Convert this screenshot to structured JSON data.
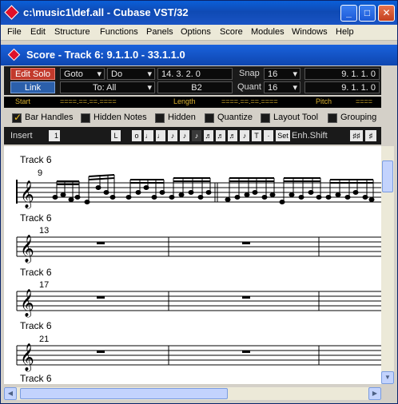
{
  "window": {
    "title": "c:\\music1\\def.all - Cubase VST/32"
  },
  "menu": [
    "File",
    "Edit",
    "Structure",
    "Functions",
    "Panels",
    "Options",
    "Score",
    "Modules",
    "Windows",
    "Help"
  ],
  "score_window": {
    "title": "Score - Track 6:  9.1.1.0 - 33.1.1.0"
  },
  "infoline": {
    "edit_solo": "Edit Solo",
    "link": "Link",
    "goto": "Goto",
    "do": "Do",
    "to_all": "To: All",
    "position": "14.  3.  2.     0",
    "note": "B2",
    "snap_label": "Snap",
    "snap_value": "16",
    "quant_label": "Quant",
    "quant_value": "16",
    "pos2": "9.  1.  1.     0",
    "pos3": "9.  1.  1.     0"
  },
  "columns": {
    "start": "Start",
    "start_val": "====.==.==.====",
    "length": "Length",
    "length_val": "====.==.==.====",
    "pitch": "Pitch",
    "pitch_val": "===="
  },
  "options": {
    "bar_handles": "Bar Handles",
    "hidden_notes": "Hidden Notes",
    "hidden": "Hidden",
    "quantize": "Quantize",
    "layout_tool": "Layout Tool",
    "grouping": "Grouping"
  },
  "toolbar": {
    "insert": "Insert",
    "insert_value": "1",
    "enh_shift": "Enh.Shift",
    "L": "L",
    "set": "Set",
    "T": "T"
  },
  "staves": [
    {
      "track": "Track 6",
      "bar": "9"
    },
    {
      "track": "Track 6",
      "bar": "13"
    },
    {
      "track": "Track 6",
      "bar": "17"
    },
    {
      "track": "Track 6",
      "bar": "21"
    },
    {
      "track": "Track 6",
      "bar": ""
    }
  ]
}
